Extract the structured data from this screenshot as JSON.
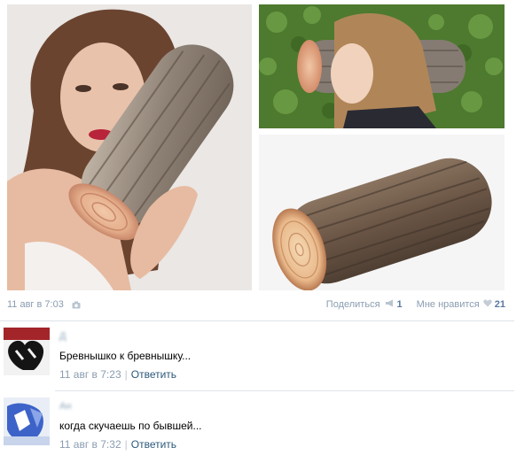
{
  "post": {
    "date": "11 авг в 7:03",
    "share_label": "Поделиться",
    "share_count": "1",
    "like_label": "Мне нравится",
    "like_count": "21"
  },
  "comments": [
    {
      "author": "Д          ",
      "text": "Бревнышко к бревнышку...",
      "time": "11 авг в 7:23",
      "separator": "|",
      "reply_label": "Ответить"
    },
    {
      "author": "Ан          ",
      "text": "когда скучаешь по бывшей...",
      "time": "11 авг в 7:32",
      "separator": "|",
      "reply_label": "Ответить"
    }
  ],
  "icons": {
    "camera": "camera-icon",
    "share": "megaphone-icon",
    "like": "heart-icon"
  },
  "colors": {
    "link": "#2b587a",
    "meta": "#8a9cb0",
    "divider": "#dfe4ea"
  }
}
